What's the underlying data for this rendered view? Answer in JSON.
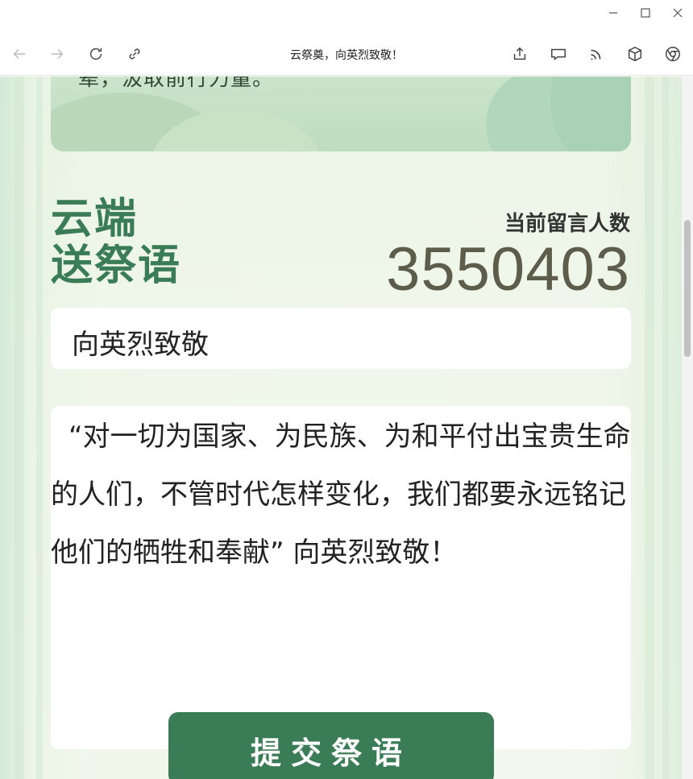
{
  "window": {
    "minimize_icon": "minimize-icon",
    "maximize_icon": "maximize-icon",
    "close_icon": "close-icon"
  },
  "browser": {
    "tab_title": "云祭奠，向英烈致敬！",
    "icons": [
      "back-icon",
      "forward-icon",
      "refresh-icon",
      "link-icon",
      "share-icon",
      "cast-icon",
      "rss-icon",
      "extension-icon",
      "chrome-icon"
    ]
  },
  "page": {
    "banner_text": "辈，汲取前行力量。",
    "title_line1": "云端",
    "title_line2": "送祭语",
    "count_label": "当前留言人数",
    "count_value": "3550403",
    "input_value": "向英烈致敬",
    "message_text": "“对一切为国家、为民族、为和平付出宝贵生命的人们，不管时代怎样变化，我们都要永远铭记他们的牺牲和奉献” 向英烈致敬！",
    "submit_label": "提交祭语"
  },
  "colors": {
    "accent": "#3a7c55",
    "count": "#5e5d4b",
    "background": "#eef6ea"
  }
}
